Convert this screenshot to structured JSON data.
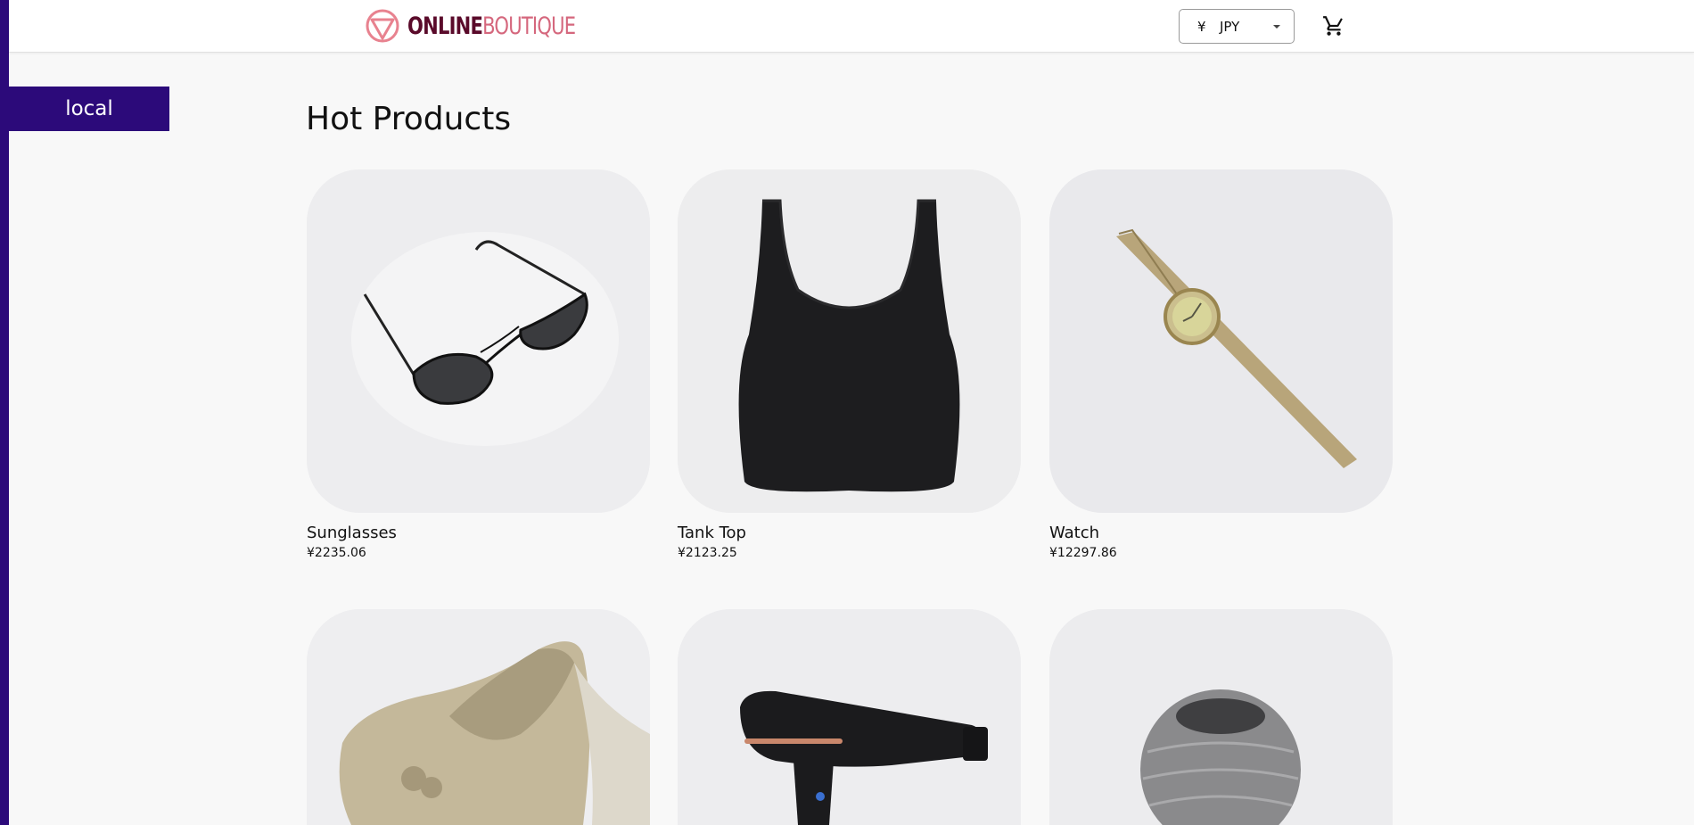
{
  "env_badge": "local",
  "header": {
    "logo_bold": "ONLINE",
    "logo_thin": "BOUTIQUE",
    "currency": {
      "symbol": "¥",
      "code": "JPY",
      "caret_icon": "caret-down-icon"
    },
    "cart_icon": "cart-icon"
  },
  "main": {
    "title": "Hot Products",
    "products": [
      {
        "name": "Sunglasses",
        "price": "¥2235.06"
      },
      {
        "name": "Tank Top",
        "price": "¥2123.25"
      },
      {
        "name": "Watch",
        "price": "¥12297.86"
      },
      {
        "name": "",
        "price": ""
      },
      {
        "name": "",
        "price": ""
      },
      {
        "name": "",
        "price": ""
      }
    ]
  },
  "colors": {
    "accent_purple": "#2c0a7a",
    "logo_dark": "#5a0a2a",
    "logo_pink": "#d5677d"
  }
}
